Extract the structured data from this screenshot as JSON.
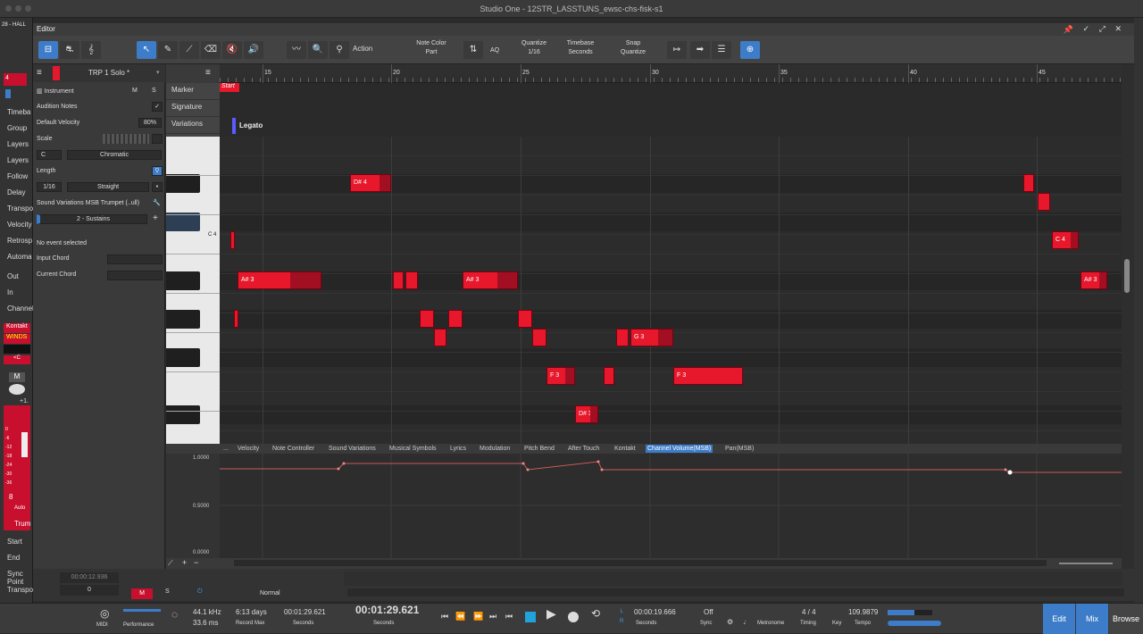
{
  "window": {
    "title": "Studio One - 12STR_LASSTUNS_ewsc-chs-fisk-s1"
  },
  "editor": {
    "title": "Editor"
  },
  "left_panel": {
    "labels": [
      "Timeba",
      "Group",
      "Layers",
      "Layers",
      "Follow",
      "Delay",
      "Transpo",
      "Velocity",
      "Retrosp",
      "Automa",
      "Out",
      "In",
      "Channel",
      "Kontakt",
      "WINDS",
      "M",
      "Trum",
      "Start",
      "End",
      "Sync Point",
      "Transpose"
    ],
    "track_num": "4",
    "top_info": "28 - HALL",
    "sync_point_value": "00:00:12.936",
    "transpose_value": "0",
    "db_value": "+1.",
    "db_scale": [
      "0",
      "-6",
      "-12",
      "-18",
      "-24",
      "-30",
      "-36"
    ],
    "auto_label": "Auto",
    "channel_num": "8"
  },
  "toolbar": {
    "action": "Action",
    "note_color_label": "Note Color",
    "note_color_value": "Part",
    "aq": "AQ",
    "quantize_label": "Quantize",
    "quantize_value": "1/16",
    "timebase_label": "Timebase",
    "timebase_value": "Seconds",
    "snap_label": "Snap",
    "snap_value": "Quantize"
  },
  "inspector": {
    "track_name": "TRP 1 Solo *",
    "instrument": "Instrument",
    "m": "M",
    "s": "S",
    "audition_notes": "Audition Notes",
    "default_velocity": "Default Velocity",
    "velocity_value": "80%",
    "scale": "Scale",
    "scale_key": "C",
    "scale_type": "Chromatic",
    "length": "Length",
    "length_value": "1/16",
    "length_mode": "Straight",
    "sound_variations": "Sound Variations MSB Trumpet (..ull)",
    "variation_value": "2 - Sustains",
    "no_event": "No event selected",
    "input_chord": "Input Chord",
    "current_chord": "Current Chord"
  },
  "markers": {
    "items": [
      "Marker",
      "Signature",
      "Variations"
    ],
    "start": "Start",
    "legato": "Legato",
    "legato_color": "#5b5bff"
  },
  "ruler": {
    "ticks": [
      "15",
      "20",
      "25",
      "30",
      "35",
      "40",
      "45"
    ]
  },
  "piano": {
    "c4_label": "C 4"
  },
  "notes": [
    {
      "label": "D# 4"
    },
    {
      "label": ""
    },
    {
      "label": ""
    },
    {
      "label": ""
    },
    {
      "label": "C 4"
    },
    {
      "label": "A# 3"
    },
    {
      "label": ""
    },
    {
      "label": ""
    },
    {
      "label": "A# 3"
    },
    {
      "label": "A# 3"
    },
    {
      "label": ""
    },
    {
      "label": ""
    },
    {
      "label": ""
    },
    {
      "label": ""
    },
    {
      "label": ""
    },
    {
      "label": ""
    },
    {
      "label": "G 3"
    },
    {
      "label": ""
    },
    {
      "label": "F 3"
    },
    {
      "label": ""
    },
    {
      "label": "F 3"
    },
    {
      "label": "D# 3"
    }
  ],
  "controller_tabs": [
    "...",
    "Velocity",
    "Note Controller",
    "Sound Variations",
    "Musical Symbols",
    "Lyrics",
    "Modulation",
    "Pitch Bend",
    "After Touch",
    "Kontakt",
    "Channel Volume(MSB)",
    "Pan(MSB)"
  ],
  "controller_values": [
    "1.0000",
    "0.5000",
    "0.0000"
  ],
  "lower": {
    "normal": "Normal",
    "m": "M",
    "s": "S"
  },
  "transport": {
    "midi": "MIDI",
    "performance": "Performance",
    "sample_rate": "44.1 kHz",
    "latency": "33.6 ms",
    "record_days": "6:13 days",
    "record_max": "Record Max",
    "pos1": "00:01:29.621",
    "pos1_unit": "Seconds",
    "main_time": "00:01:29.621",
    "main_unit": "Seconds",
    "loop_time": "00:00:19.666",
    "loop_unit": "Seconds",
    "sync_state": "Off",
    "sync": "Sync",
    "metronome": "Metronome",
    "timing_value": "4 / 4",
    "timing": "Timing",
    "key": "Key",
    "tempo_value": "109.9879",
    "tempo": "Tempo",
    "edit": "Edit",
    "mix": "Mix",
    "browse": "Browse",
    "accent": "#3d7cc9"
  }
}
